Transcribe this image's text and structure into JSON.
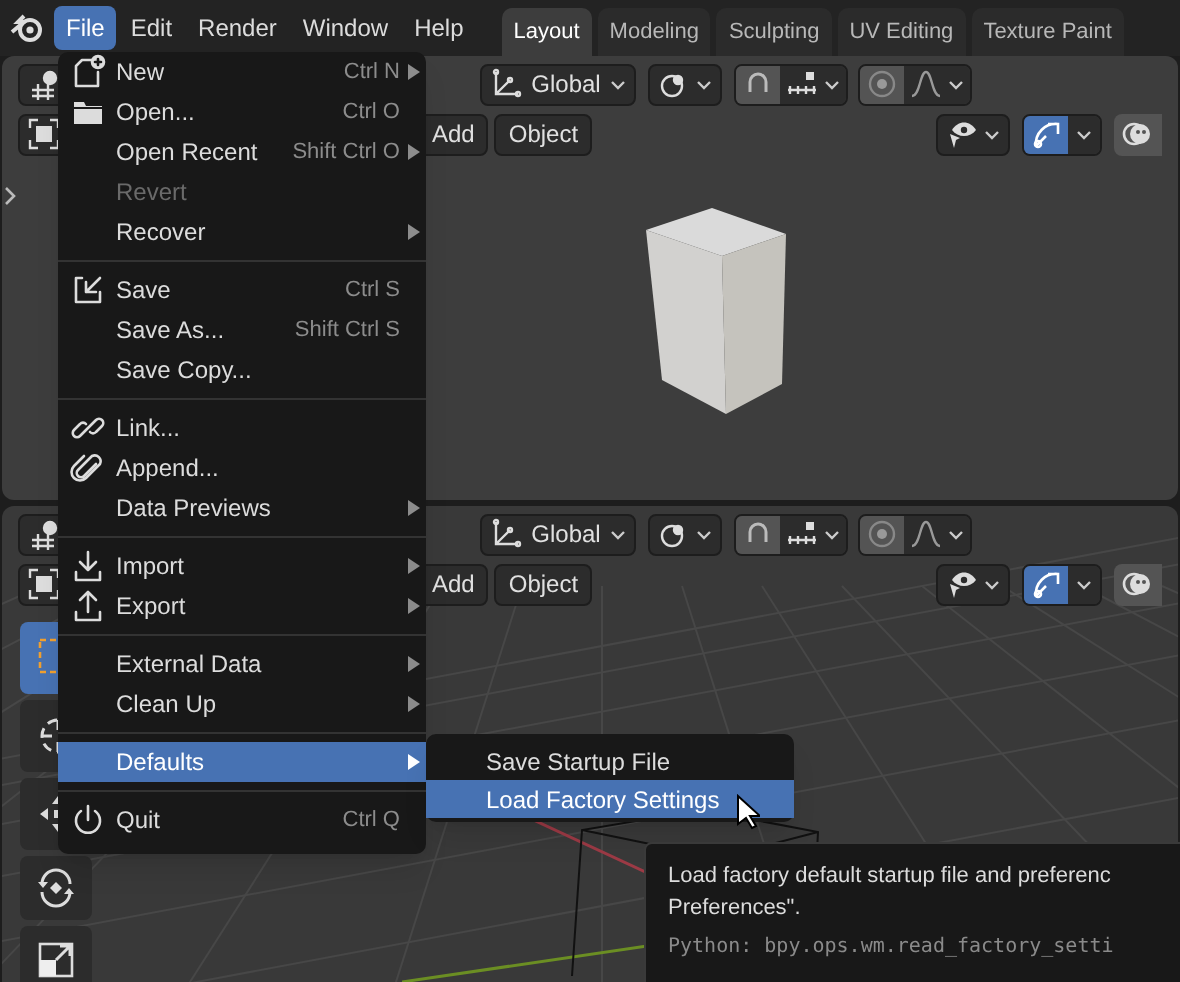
{
  "topbar": {
    "menus": [
      {
        "label": "File",
        "selected": true
      },
      {
        "label": "Edit",
        "selected": false
      },
      {
        "label": "Render",
        "selected": false
      },
      {
        "label": "Window",
        "selected": false
      },
      {
        "label": "Help",
        "selected": false
      }
    ],
    "workspaces": [
      {
        "label": "Layout",
        "selected": true
      },
      {
        "label": "Modeling",
        "selected": false
      },
      {
        "label": "Sculpting",
        "selected": false
      },
      {
        "label": "UV Editing",
        "selected": false
      },
      {
        "label": "Texture Paint",
        "selected": false
      }
    ]
  },
  "viewports": [
    {
      "transform": "Global",
      "menus": [
        "Add",
        "Object"
      ]
    },
    {
      "transform": "Global",
      "menus": [
        "Add",
        "Object"
      ]
    }
  ],
  "file_menu": {
    "items": [
      {
        "kind": "item",
        "label": "New",
        "shortcut": "Ctrl N",
        "submenu": true,
        "disabled": false,
        "selected": false
      },
      {
        "kind": "item",
        "label": "Open...",
        "shortcut": "Ctrl O",
        "submenu": false,
        "disabled": false,
        "selected": false
      },
      {
        "kind": "item",
        "label": "Open Recent",
        "shortcut": "Shift Ctrl O",
        "submenu": true,
        "disabled": false,
        "selected": false
      },
      {
        "kind": "item",
        "label": "Revert",
        "submenu": false,
        "disabled": true,
        "selected": false
      },
      {
        "kind": "item",
        "label": "Recover",
        "submenu": true,
        "disabled": false,
        "selected": false
      },
      {
        "kind": "separator"
      },
      {
        "kind": "item",
        "label": "Save",
        "shortcut": "Ctrl S",
        "submenu": false,
        "disabled": false,
        "selected": false
      },
      {
        "kind": "item",
        "label": "Save As...",
        "shortcut": "Shift Ctrl S",
        "submenu": false,
        "disabled": false,
        "selected": false
      },
      {
        "kind": "item",
        "label": "Save Copy...",
        "submenu": false,
        "disabled": false,
        "selected": false
      },
      {
        "kind": "separator"
      },
      {
        "kind": "item",
        "label": "Link...",
        "submenu": false,
        "disabled": false,
        "selected": false
      },
      {
        "kind": "item",
        "label": "Append...",
        "submenu": false,
        "disabled": false,
        "selected": false
      },
      {
        "kind": "item",
        "label": "Data Previews",
        "submenu": true,
        "disabled": false,
        "selected": false
      },
      {
        "kind": "separator"
      },
      {
        "kind": "item",
        "label": "Import",
        "submenu": true,
        "disabled": false,
        "selected": false
      },
      {
        "kind": "item",
        "label": "Export",
        "submenu": true,
        "disabled": false,
        "selected": false
      },
      {
        "kind": "separator"
      },
      {
        "kind": "item",
        "label": "External Data",
        "submenu": true,
        "disabled": false,
        "selected": false
      },
      {
        "kind": "item",
        "label": "Clean Up",
        "submenu": true,
        "disabled": false,
        "selected": false
      },
      {
        "kind": "separator"
      },
      {
        "kind": "item",
        "label": "Defaults",
        "submenu": true,
        "disabled": false,
        "selected": true
      },
      {
        "kind": "separator"
      },
      {
        "kind": "item",
        "label": "Quit",
        "shortcut": "Ctrl Q",
        "submenu": false,
        "disabled": false,
        "selected": false
      }
    ]
  },
  "defaults_submenu": {
    "items": [
      {
        "label": "Save Startup File",
        "selected": false
      },
      {
        "label": "Load Factory Settings",
        "selected": true
      }
    ]
  },
  "tooltip": {
    "lines": [
      "Load factory default startup file and preferenc",
      "Preferences\"."
    ],
    "python": "Python: bpy.ops.wm.read_factory_setti"
  }
}
